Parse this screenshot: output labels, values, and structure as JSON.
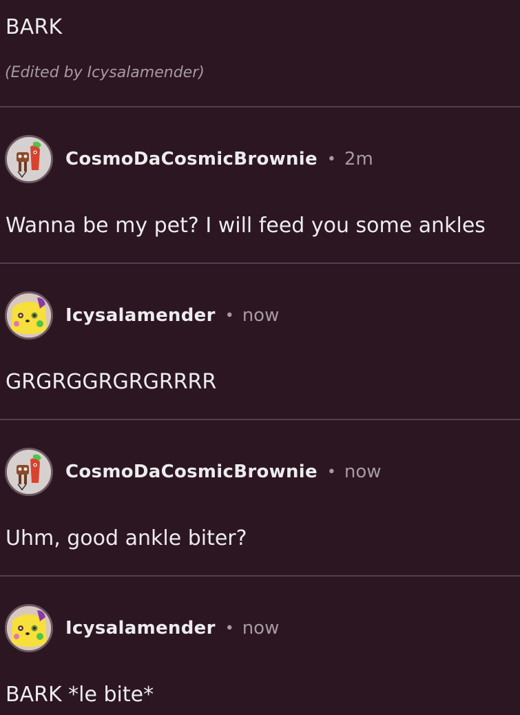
{
  "top_post": {
    "text": "BARK",
    "edited_note": "(Edited by Icysalamender)"
  },
  "comments": [
    {
      "username": "CosmoDaCosmicBrownie",
      "separator": "•",
      "time": "2m",
      "text": "Wanna be my pet? I will feed you some ankles",
      "avatar_icon": "brownie-characters-avatar-icon"
    },
    {
      "username": "Icysalamender",
      "separator": "•",
      "time": "now",
      "text": "GRGRGGRGRGRRRR",
      "avatar_icon": "yellow-creature-avatar-icon"
    },
    {
      "username": "CosmoDaCosmicBrownie",
      "separator": "•",
      "time": "now",
      "text": "Uhm, good ankle biter?",
      "avatar_icon": "brownie-characters-avatar-icon"
    },
    {
      "username": "Icysalamender",
      "separator": "•",
      "time": "now",
      "text": "BARK *le bite*",
      "avatar_icon": "yellow-creature-avatar-icon"
    }
  ],
  "colors": {
    "background": "#2c1622",
    "divider": "#54404c",
    "text": "#ececec",
    "muted": "#a79aa2"
  }
}
